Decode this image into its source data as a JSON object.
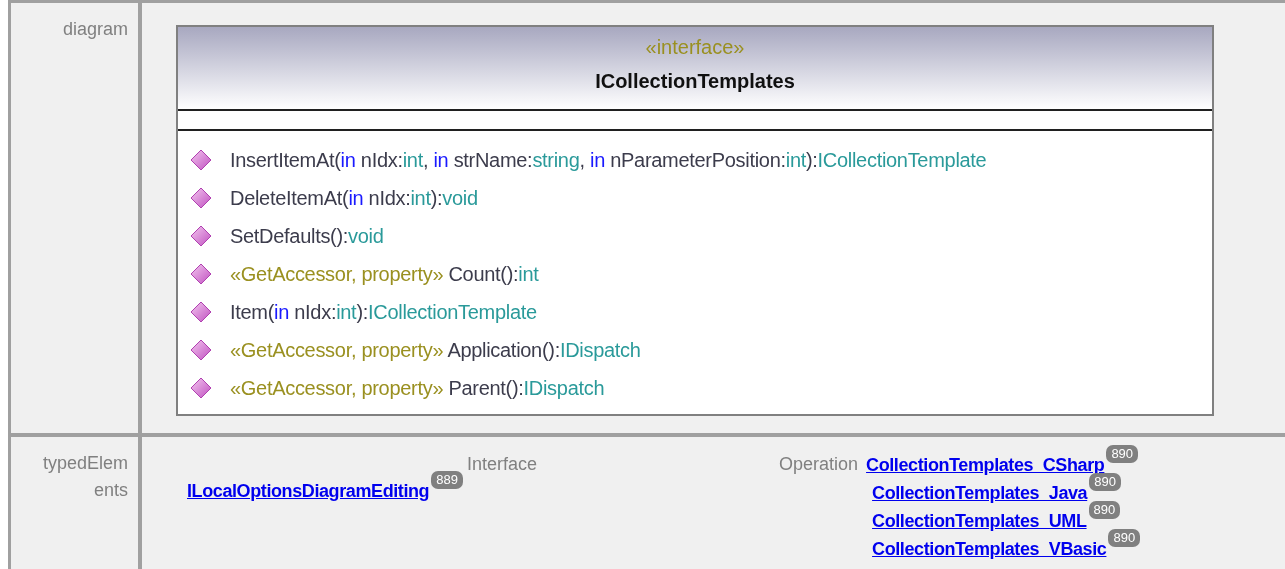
{
  "rows": [
    {
      "label": "diagram",
      "kind": "diagram",
      "diagram": {
        "stereotype": "«interface»",
        "name": "ICollectionTemplates",
        "operations": [
          {
            "segments": [
              {
                "kind": "name",
                "text": "InsertItemAt("
              },
              {
                "kind": "keyword",
                "text": "in"
              },
              {
                "kind": "name",
                "text": " nIdx:"
              },
              {
                "kind": "type",
                "text": "int"
              },
              {
                "kind": "name",
                "text": ", "
              },
              {
                "kind": "keyword",
                "text": "in"
              },
              {
                "kind": "name",
                "text": " strName:"
              },
              {
                "kind": "type",
                "text": "string"
              },
              {
                "kind": "name",
                "text": ", "
              },
              {
                "kind": "keyword",
                "text": "in"
              },
              {
                "kind": "name",
                "text": " nParameterPosition:"
              },
              {
                "kind": "type",
                "text": "int"
              },
              {
                "kind": "name",
                "text": "):"
              },
              {
                "kind": "type",
                "text": "ICollectionTemplate"
              }
            ]
          },
          {
            "segments": [
              {
                "kind": "name",
                "text": "DeleteItemAt("
              },
              {
                "kind": "keyword",
                "text": "in"
              },
              {
                "kind": "name",
                "text": " nIdx:"
              },
              {
                "kind": "type",
                "text": "int"
              },
              {
                "kind": "name",
                "text": "):"
              },
              {
                "kind": "type",
                "text": "void"
              }
            ]
          },
          {
            "segments": [
              {
                "kind": "name",
                "text": "SetDefaults():"
              },
              {
                "kind": "type",
                "text": "void"
              }
            ]
          },
          {
            "segments": [
              {
                "kind": "stereotype",
                "text": "«GetAccessor, property» "
              },
              {
                "kind": "name",
                "text": "Count():"
              },
              {
                "kind": "type",
                "text": "int"
              }
            ]
          },
          {
            "segments": [
              {
                "kind": "name",
                "text": "Item("
              },
              {
                "kind": "keyword",
                "text": "in"
              },
              {
                "kind": "name",
                "text": " nIdx:"
              },
              {
                "kind": "type",
                "text": "int"
              },
              {
                "kind": "name",
                "text": "):"
              },
              {
                "kind": "type",
                "text": "ICollectionTemplate"
              }
            ]
          },
          {
            "segments": [
              {
                "kind": "stereotype",
                "text": "«GetAccessor, property» "
              },
              {
                "kind": "name",
                "text": "Application():"
              },
              {
                "kind": "type",
                "text": "IDispatch"
              }
            ]
          },
          {
            "segments": [
              {
                "kind": "stereotype",
                "text": "«GetAccessor, property» "
              },
              {
                "kind": "name",
                "text": "Parent():"
              },
              {
                "kind": "type",
                "text": "IDispatch"
              }
            ]
          }
        ]
      }
    },
    {
      "label": "typedElem ents",
      "kind": "references",
      "columns": [
        {
          "header": "Interface",
          "links": [
            {
              "text": "ILocalOptionsDiagramEditing",
              "count": "889"
            }
          ]
        },
        {
          "header": "Operation",
          "links": [
            {
              "text": "CollectionTemplates_CSharp",
              "count": "890"
            },
            {
              "text": "CollectionTemplates_Java",
              "count": "890"
            },
            {
              "text": "CollectionTemplates_UML",
              "count": "890"
            },
            {
              "text": "CollectionTemplates_VBasic",
              "count": "890"
            }
          ]
        }
      ]
    }
  ]
}
